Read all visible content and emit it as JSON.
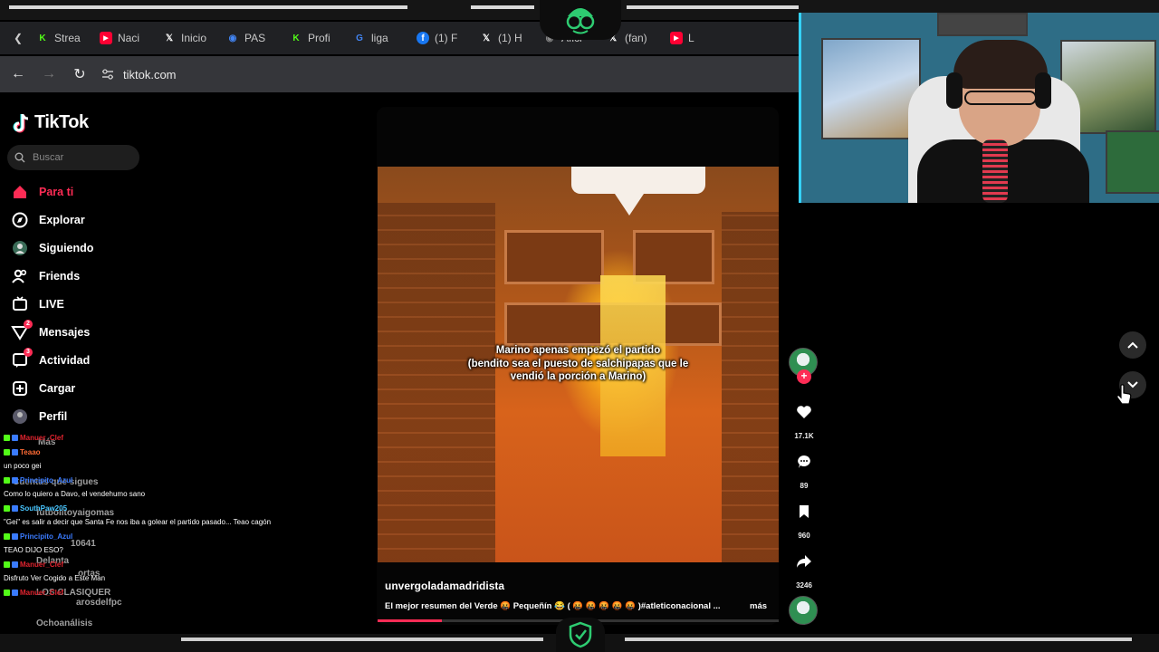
{
  "browser": {
    "tabs": [
      {
        "label": "Strea",
        "icon": "kick-icon",
        "color": "#53fc18"
      },
      {
        "label": "Naci",
        "icon": "youtube-icon",
        "color": "#ff0033"
      },
      {
        "label": "Inicio",
        "icon": "x-icon",
        "color": "#ffffff"
      },
      {
        "label": "PAS",
        "icon": "app-icon",
        "color": "#4285f4"
      },
      {
        "label": "Profi",
        "icon": "kick-icon",
        "color": "#53fc18"
      },
      {
        "label": "liga",
        "icon": "google-icon",
        "color": "#4285f4"
      },
      {
        "label": "(1) F",
        "icon": "facebook-icon",
        "color": "#1877f2"
      },
      {
        "label": "(1) H",
        "icon": "x-icon",
        "color": "#ffffff"
      },
      {
        "label": "Afici",
        "icon": "app-icon",
        "color": "#888888"
      },
      {
        "label": "(fan)",
        "icon": "x-icon",
        "color": "#ffffff"
      },
      {
        "label": "L",
        "icon": "youtube-icon",
        "color": "#ff0033"
      }
    ],
    "url": "tiktok.com"
  },
  "tiktok": {
    "brand": "TikTok",
    "search_placeholder": "Buscar",
    "nav": [
      {
        "label": "Para ti",
        "icon": "home-icon",
        "active": true
      },
      {
        "label": "Explorar",
        "icon": "compass-icon"
      },
      {
        "label": "Siguiendo",
        "icon": "following-icon"
      },
      {
        "label": "Friends",
        "icon": "friends-icon"
      },
      {
        "label": "LIVE",
        "icon": "live-icon"
      },
      {
        "label": "Mensajes",
        "icon": "messages-icon",
        "badge": "2"
      },
      {
        "label": "Actividad",
        "icon": "activity-icon",
        "badge": "3"
      },
      {
        "label": "Cargar",
        "icon": "upload-icon"
      },
      {
        "label": "Perfil",
        "icon": "profile-icon"
      }
    ],
    "under_chat": [
      "Más",
      "Cuentas que sigues",
      "futbolitoyaigomas",
      "10641",
      "Delanta",
      "ortas",
      "LOS CLASIQUER",
      "arosdelfpc",
      "Ochoanálisis"
    ]
  },
  "chat": [
    {
      "name": "Manuer_Clef",
      "name_color": "#e0232e",
      "message": ""
    },
    {
      "name": "Teaao",
      "name_color": "#ff6b35",
      "message": ""
    },
    {
      "name": "",
      "name_color": "#ffffff",
      "message": "un poco gei"
    },
    {
      "name": "Principito_Azul",
      "name_color": "#3a7bff",
      "message": ""
    },
    {
      "name": "",
      "name_color": "#ffffff",
      "message": "Como lo quiero a Davo, el vendehumo sano"
    },
    {
      "name": "SouthPaw205",
      "name_color": "#48c6ff",
      "message": ""
    },
    {
      "name": "",
      "name_color": "#ffffff",
      "message": "\"Gei\" es salir a decir que Santa Fe nos iba a golear el partido pasado... Teao cagón"
    },
    {
      "name": "Principito_Azul",
      "name_color": "#3a7bff",
      "message": ""
    },
    {
      "name": "",
      "name_color": "#ffffff",
      "message": "TEAO DIJO ESO?"
    },
    {
      "name": "Manuer_Clef",
      "name_color": "#e0232e",
      "message": ""
    },
    {
      "name": "",
      "name_color": "#ffffff",
      "message": "Disfruto Ver Cogido a Este Man"
    },
    {
      "name": "Manuer_Clef",
      "name_color": "#e0232e",
      "message": ""
    }
  ],
  "video": {
    "caption_line1": "Marino apenas empezó el partido",
    "caption_line2": "(bendito sea el puesto de salchipapas que le",
    "caption_line3": "vendió la porción a Marino)",
    "author": "unvergoladamadridista",
    "description": "El mejor resumen del Verde 🤬 Pequeñín 😂 ( 🤬 🤬 🤬 🤬 🤬 )#atleticonacional ...",
    "more": "más",
    "progress": 0.16
  },
  "actions": {
    "likes": "17.1K",
    "comments": "89",
    "saves": "960",
    "shares": "3246"
  },
  "colors": {
    "accent": "#fe2c55",
    "cam_border": "#35d2ff",
    "stream_green": "#2ecc71"
  }
}
